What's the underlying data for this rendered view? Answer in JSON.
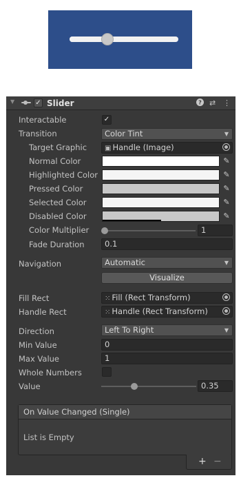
{
  "preview": {
    "slider_value": 0.35,
    "background_color": "#2d4e8a"
  },
  "header": {
    "title": "Slider",
    "enabled_mark": "✓",
    "help_icon": "?",
    "presets_icon": "⇄",
    "menu_icon": "⋮",
    "component_icon": "slider-component-icon"
  },
  "fields": {
    "interactable": {
      "label": "Interactable",
      "checked_mark": "✓"
    },
    "transition": {
      "label": "Transition",
      "value": "Color Tint"
    },
    "target_graphic": {
      "label": "Target Graphic",
      "value": "Handle (Image)"
    },
    "normal_color": {
      "label": "Normal Color",
      "color": "#ffffff"
    },
    "highlighted_color": {
      "label": "Highlighted Color",
      "color": "#f5f5f5"
    },
    "pressed_color": {
      "label": "Pressed Color",
      "color": "#c8c8c8"
    },
    "selected_color": {
      "label": "Selected Color",
      "color": "#f5f5f5"
    },
    "disabled_color": {
      "label": "Disabled Color",
      "color": "#c8c8c8",
      "alpha": 0.5
    },
    "color_multiplier": {
      "label": "Color Multiplier",
      "value": "1",
      "level": 0.0
    },
    "fade_duration": {
      "label": "Fade Duration",
      "value": "0.1"
    },
    "navigation": {
      "label": "Navigation",
      "value": "Automatic"
    },
    "visualize": {
      "label": "Visualize"
    },
    "fill_rect": {
      "label": "Fill Rect",
      "value": "Fill (Rect Transform)"
    },
    "handle_rect": {
      "label": "Handle Rect",
      "value": "Handle (Rect Transform)"
    },
    "direction": {
      "label": "Direction",
      "value": "Left To Right"
    },
    "min_value": {
      "label": "Min Value",
      "value": "0"
    },
    "max_value": {
      "label": "Max Value",
      "value": "1"
    },
    "whole_numbers": {
      "label": "Whole Numbers",
      "checked": false
    },
    "value": {
      "label": "Value",
      "value": "0.35",
      "level": 0.35
    }
  },
  "event": {
    "title": "On Value Changed (Single)",
    "empty_text": "List is Empty",
    "add_label": "+",
    "remove_label": "−"
  },
  "icons": {
    "eyedropper": "eyedropper-icon",
    "object_picker": "object-picker-icon",
    "dropdown_arrow": "▼",
    "foldout": "▼"
  }
}
